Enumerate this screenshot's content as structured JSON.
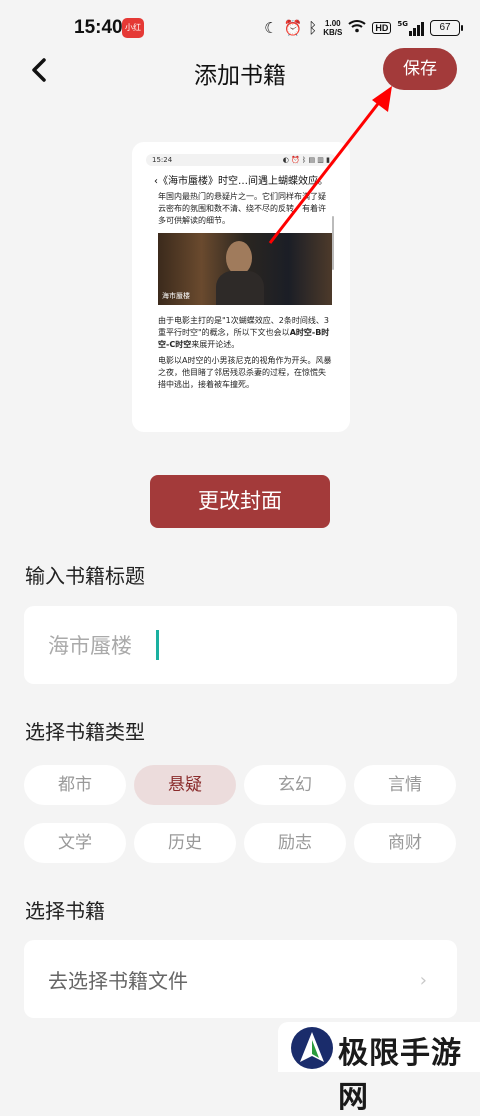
{
  "status_bar": {
    "time": "15:40",
    "app_badge": "小红书",
    "net_speed_value": "1.00",
    "net_speed_unit": "KB/S",
    "hd": "HD",
    "signal": "5G",
    "battery": "67"
  },
  "header": {
    "title": "添加书籍",
    "save_label": "保存"
  },
  "cover_preview": {
    "time": "15:24",
    "headline": "《海市蜃楼》时空…间遇上蝴蝶效应。",
    "para1": "年国内最热门的悬疑片之一。它们同样布满了疑云密布的氛围和数不清、绕不尽的反转，有着许多可供解读的细节。",
    "image_caption": "海市蜃楼",
    "para2_a": "由于电影主打的是\"1次蝴蝶效应、2条时间线、3重平行时空\"的概念，所以下文也会以",
    "para2_b": "A时空-B时空-C时空",
    "para2_c": "来展开论述。",
    "para3": "电影以A时空的小男孩尼克的视角作为开头。风暴之夜，他目睹了邻居残忍杀妻的过程，在惊慌失措中逃出，接着被车撞死。"
  },
  "change_cover_label": "更改封面",
  "title_section": {
    "label": "输入书籍标题",
    "value": "海市蜃楼"
  },
  "type_section": {
    "label": "选择书籍类型",
    "chips": [
      "都市",
      "悬疑",
      "玄幻",
      "言情",
      "文学",
      "历史",
      "励志",
      "商财"
    ],
    "selected": "悬疑"
  },
  "file_section": {
    "label": "选择书籍",
    "select_text": "去选择书籍文件"
  },
  "watermark": {
    "text": "极限手游网"
  },
  "colors": {
    "accent": "#a33a3a",
    "chip_active_bg": "#ecdcdc",
    "background": "#f4f4f4"
  }
}
